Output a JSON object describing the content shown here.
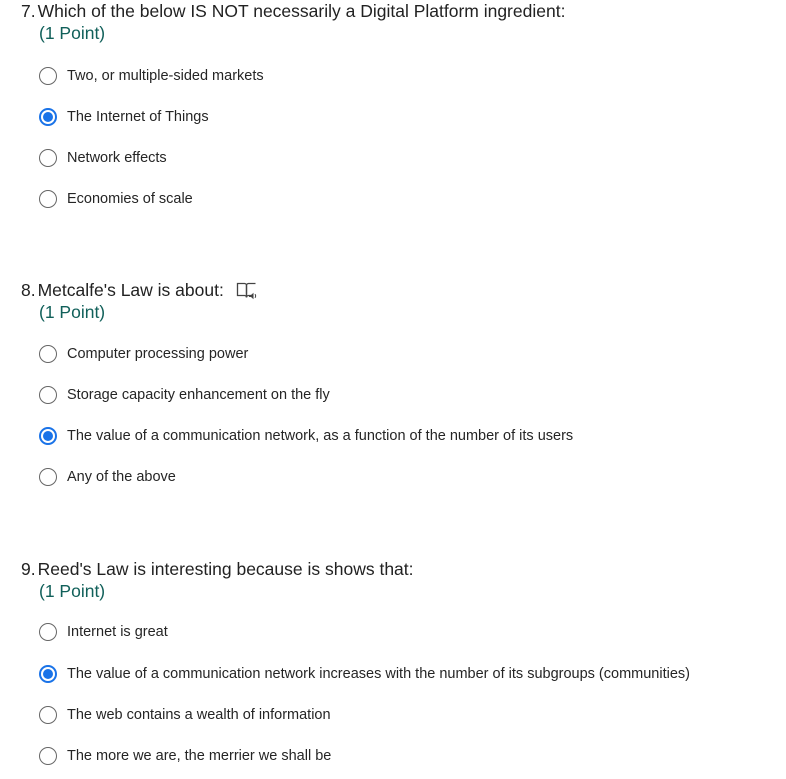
{
  "questions": [
    {
      "number": "7.",
      "text": "Which of the below IS NOT necessarily a Digital Platform ingredient:",
      "points": "(1 Point)",
      "has_reader_icon": false,
      "options": [
        {
          "label": "Two, or multiple-sided markets",
          "selected": false
        },
        {
          "label": "The Internet of Things",
          "selected": true
        },
        {
          "label": "Network effects",
          "selected": false
        },
        {
          "label": "Economies of scale",
          "selected": false
        }
      ]
    },
    {
      "number": "8.",
      "text": "Metcalfe's Law is about:",
      "points": "(1 Point)",
      "has_reader_icon": true,
      "options": [
        {
          "label": "Computer processing power",
          "selected": false
        },
        {
          "label": "Storage capacity enhancement on the fly",
          "selected": false
        },
        {
          "label": "The value of a communication network, as a function of the number of its users",
          "selected": true
        },
        {
          "label": "Any of the above",
          "selected": false
        }
      ]
    },
    {
      "number": "9.",
      "text": "Reed's Law is interesting because is shows that:",
      "points": "(1 Point)",
      "has_reader_icon": false,
      "options": [
        {
          "label": "Internet is great",
          "selected": false
        },
        {
          "label": "The value of a communication network increases with the number of its subgroups (communities)",
          "selected": true
        },
        {
          "label": "The web contains a wealth of information",
          "selected": false
        },
        {
          "label": "The more we are, the merrier we shall be",
          "selected": false
        }
      ]
    }
  ],
  "colors": {
    "accent": "#1a73e8",
    "points": "#11605a",
    "text": "#222222"
  }
}
